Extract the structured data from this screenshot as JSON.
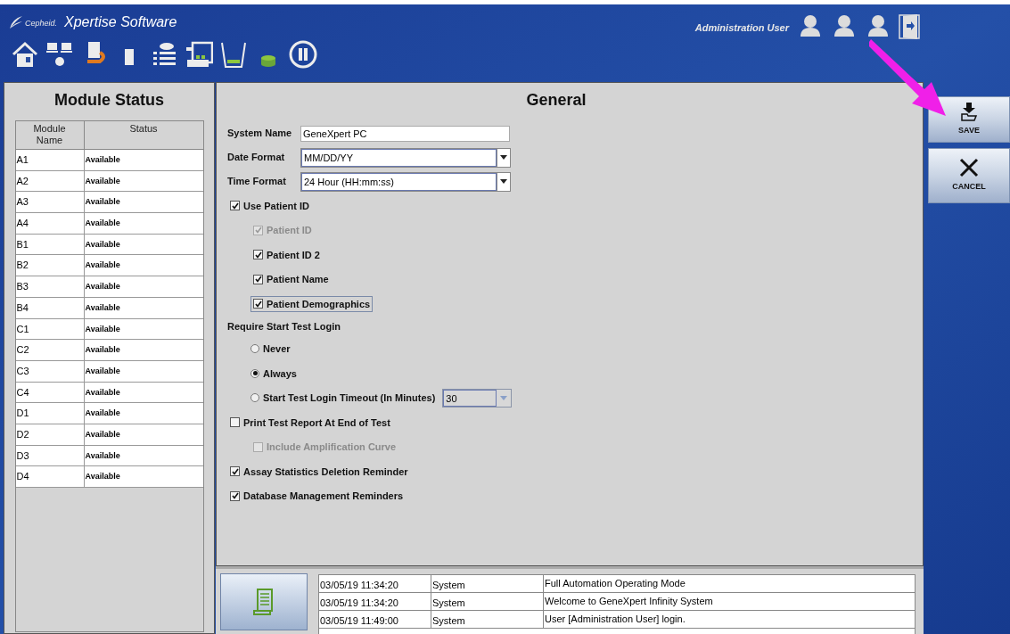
{
  "header": {
    "brand": "Cepheid.",
    "app_title": "Xpertise Software",
    "user": "Administration User"
  },
  "module_status": {
    "title": "Module Status",
    "columns": [
      "Module Name",
      "Status"
    ],
    "rows": [
      [
        "A1",
        "Available"
      ],
      [
        "A2",
        "Available"
      ],
      [
        "A3",
        "Available"
      ],
      [
        "A4",
        "Available"
      ],
      [
        "B1",
        "Available"
      ],
      [
        "B2",
        "Available"
      ],
      [
        "B3",
        "Available"
      ],
      [
        "B4",
        "Available"
      ],
      [
        "C1",
        "Available"
      ],
      [
        "C2",
        "Available"
      ],
      [
        "C3",
        "Available"
      ],
      [
        "C4",
        "Available"
      ],
      [
        "D1",
        "Available"
      ],
      [
        "D2",
        "Available"
      ],
      [
        "D3",
        "Available"
      ],
      [
        "D4",
        "Available"
      ]
    ]
  },
  "general": {
    "title": "General",
    "fields": [
      {
        "kind": "text",
        "label": "System Name",
        "value": "GeneXpert PC"
      },
      {
        "kind": "select",
        "label": "Date Format",
        "value": "MM/DD/YY"
      },
      {
        "kind": "select",
        "label": "Time Format",
        "value": "24 Hour (HH:mm:ss)"
      }
    ],
    "options": [
      {
        "kind": "checkbox",
        "label": "Use Patient ID",
        "checked": true,
        "disabled": false,
        "focused": false,
        "children": [
          {
            "kind": "checkbox",
            "label": "Patient ID",
            "checked": true,
            "disabled": true,
            "focused": false
          },
          {
            "kind": "checkbox",
            "label": "Patient ID 2",
            "checked": true,
            "disabled": false,
            "focused": false
          },
          {
            "kind": "checkbox",
            "label": "Patient Name",
            "checked": true,
            "disabled": false,
            "focused": false
          },
          {
            "kind": "checkbox",
            "label": "Patient Demographics",
            "checked": true,
            "disabled": false,
            "focused": true
          }
        ]
      },
      {
        "kind": "heading",
        "label": "Require Start Test Login",
        "children": [
          {
            "kind": "radio",
            "label": "Never",
            "selected": false
          },
          {
            "kind": "radio",
            "label": "Always",
            "selected": true
          },
          {
            "kind": "radio",
            "label": "Start Test Login Timeout (In Minutes)",
            "selected": false,
            "select_value": "30"
          }
        ]
      },
      {
        "kind": "checkbox",
        "label": "Print Test Report At End of Test",
        "checked": false,
        "disabled": false,
        "focused": false,
        "children": [
          {
            "kind": "checkbox",
            "label": "Include Amplification Curve",
            "checked": false,
            "disabled": true,
            "focused": false
          }
        ]
      },
      {
        "kind": "checkbox",
        "label": "Assay Statistics Deletion Reminder",
        "checked": true,
        "disabled": false,
        "focused": false
      },
      {
        "kind": "checkbox",
        "label": "Database Management Reminders",
        "checked": true,
        "disabled": false,
        "focused": false
      }
    ]
  },
  "actions": [
    {
      "kind": "save",
      "label": "SAVE"
    },
    {
      "kind": "cancel",
      "label": "CANCEL"
    }
  ],
  "log": {
    "rows": [
      [
        "03/05/19 11:34:20",
        "System",
        "Full Automation Operating Mode"
      ],
      [
        "03/05/19 11:34:20",
        "System",
        "Welcome to GeneXpert Infinity System"
      ],
      [
        "03/05/19 11:49:00",
        "System",
        "User [Administration User] login."
      ]
    ]
  }
}
